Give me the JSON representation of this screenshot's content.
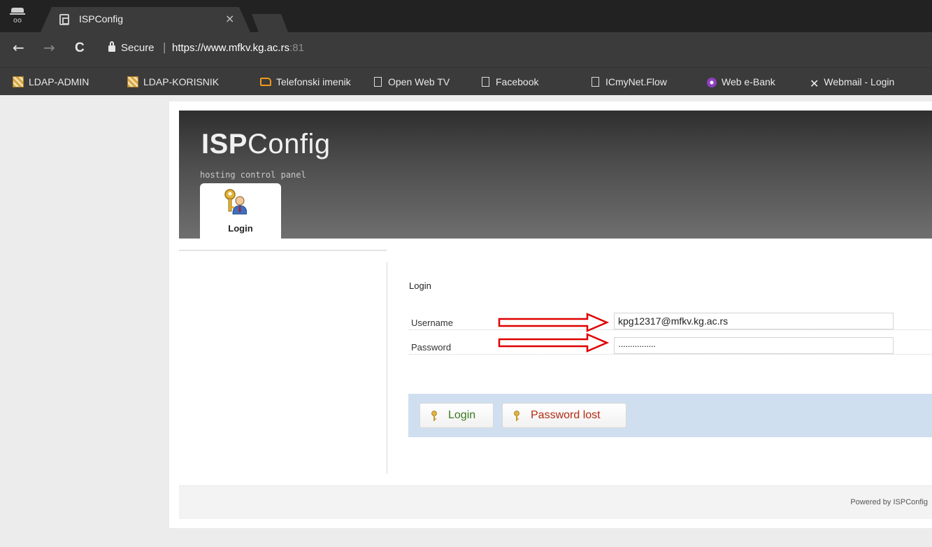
{
  "browser": {
    "tab_title": "ISPConfig",
    "tab_close": "×",
    "secure_label": "Secure",
    "url_main": "https://www.mfkv.kg.ac.rs",
    "url_port": ":81",
    "back": "←",
    "forward": "→",
    "reload": "C"
  },
  "bookmarks": [
    {
      "label": "LDAP-ADMIN",
      "icon": "ldap-icon"
    },
    {
      "label": "LDAP-KORISNIK",
      "icon": "ldap-icon"
    },
    {
      "label": "Telefonski imenik",
      "icon": "folder-icon"
    },
    {
      "label": "Open Web TV",
      "icon": "page-icon"
    },
    {
      "label": "Facebook",
      "icon": "page-icon"
    },
    {
      "label": "ICmyNet.Flow",
      "icon": "page-icon"
    },
    {
      "label": "Web e-Bank",
      "icon": "bank-icon"
    },
    {
      "label": "Webmail - Login",
      "icon": "tools-icon"
    }
  ],
  "header": {
    "logo_bold": "ISP",
    "logo_rest": "Config",
    "tagline": "hosting control panel",
    "nav_tab": "Login"
  },
  "form": {
    "title": "Login",
    "username_label": "Username",
    "username_value": "kpg12317@mfkv.kg.ac.rs",
    "password_label": "Password",
    "password_value": "················",
    "login_button": "Login",
    "lost_button": "Password lost"
  },
  "footer": {
    "text": "Powered by ISPConfig"
  },
  "colors": {
    "arrow": "#e00000",
    "button_bar": "#cfdff0",
    "login_text": "#3a7a1f",
    "lost_text": "#b32b12"
  }
}
